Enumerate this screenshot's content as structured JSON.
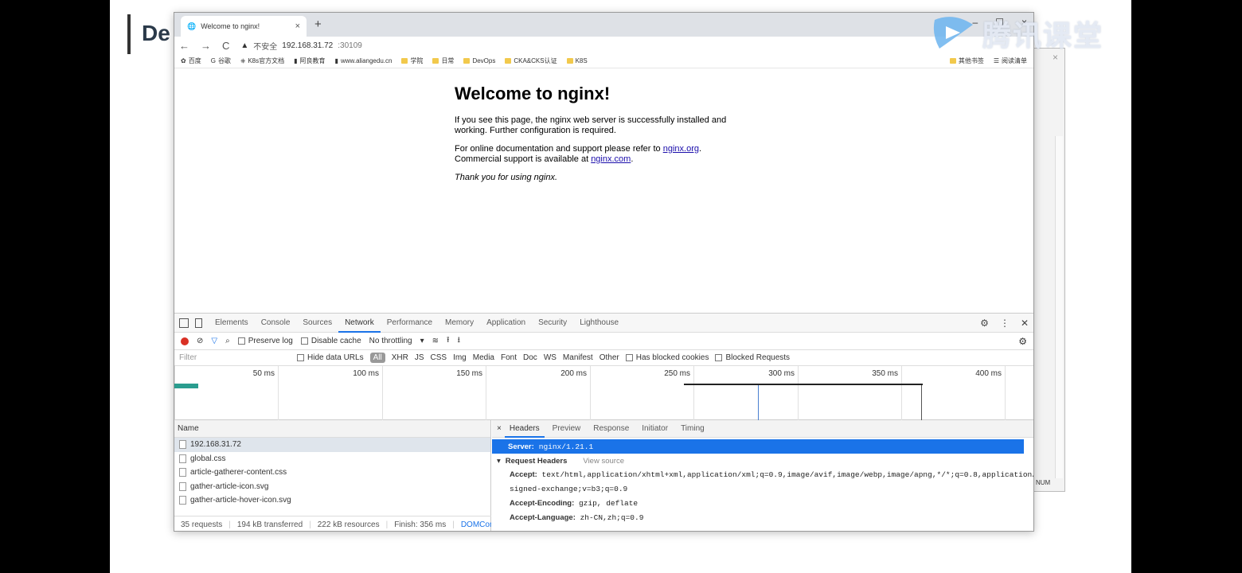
{
  "slide": {
    "title": "De"
  },
  "watermark": {
    "text": "腾讯课堂"
  },
  "bg_window": {
    "close": "×",
    "num": "NUM"
  },
  "browser": {
    "tab_title": "Welcome to nginx!",
    "tab_close": "×",
    "new_tab": "+",
    "window_controls": [
      "–",
      "☐",
      "×"
    ],
    "nav": {
      "back": "←",
      "forward": "→",
      "reload": "C"
    },
    "address": {
      "warning": "▲",
      "insecure": "不安全",
      "host": "192.168.31.72",
      "port": ":30109"
    },
    "bookmarks": [
      "百度",
      "谷歌",
      "K8s官方文档",
      "阿良教育",
      "www.aliangedu.cn",
      "学院",
      "日常",
      "DevOps",
      "CKA&CKS认证",
      "K8S"
    ],
    "bookmarks_right": [
      "其他书签",
      "阅读清单"
    ]
  },
  "nginx": {
    "heading": "Welcome to nginx!",
    "p1": "If you see this page, the nginx web server is successfully installed and working. Further configuration is required.",
    "p2_prefix": "For online documentation and support please refer to ",
    "p2_link1": "nginx.org",
    "p2_mid": ". Commercial support is available at ",
    "p2_link2": "nginx.com",
    "p2_suffix": ".",
    "thanks": "Thank you for using nginx."
  },
  "devtools": {
    "tabs": [
      "Elements",
      "Console",
      "Sources",
      "Network",
      "Performance",
      "Memory",
      "Application",
      "Security",
      "Lighthouse"
    ],
    "active_tab": "Network",
    "toolbar": {
      "preserve_log": "Preserve log",
      "disable_cache": "Disable cache",
      "throttling": "No throttling"
    },
    "filter": {
      "placeholder": "Filter",
      "hide_data_urls": "Hide data URLs",
      "types": [
        "All",
        "XHR",
        "JS",
        "CSS",
        "Img",
        "Media",
        "Font",
        "Doc",
        "WS",
        "Manifest",
        "Other"
      ],
      "has_blocked_cookies": "Has blocked cookies",
      "blocked_requests": "Blocked Requests"
    },
    "timeline_ticks": [
      "50 ms",
      "100 ms",
      "150 ms",
      "200 ms",
      "250 ms",
      "300 ms",
      "350 ms",
      "400 ms"
    ],
    "name_header": "Name",
    "requests": [
      "192.168.31.72",
      "global.css",
      "article-gatherer-content.css",
      "gather-article-icon.svg",
      "gather-article-hover-icon.svg"
    ],
    "status": {
      "requests": "35 requests",
      "transferred": "194 kB transferred",
      "resources": "222 kB resources",
      "finish": "Finish: 356 ms",
      "dom": "DOMConter"
    },
    "detail_tabs": [
      "Headers",
      "Preview",
      "Response",
      "Initiator",
      "Timing"
    ],
    "detail_close": "×",
    "server_key": "Server:",
    "server_value": "nginx/1.21.1",
    "request_headers_title": "Request Headers",
    "view_source": "View source",
    "headers": [
      {
        "key": "Accept:",
        "value": "text/html,application/xhtml+xml,application/xml;q=0.9,image/avif,image/webp,image/apng,*/*;q=0.8,application/"
      },
      {
        "key": "",
        "value": "signed-exchange;v=b3;q=0.9"
      },
      {
        "key": "Accept-Encoding:",
        "value": "gzip, deflate"
      },
      {
        "key": "Accept-Language:",
        "value": "zh-CN,zh;q=0.9"
      }
    ]
  }
}
